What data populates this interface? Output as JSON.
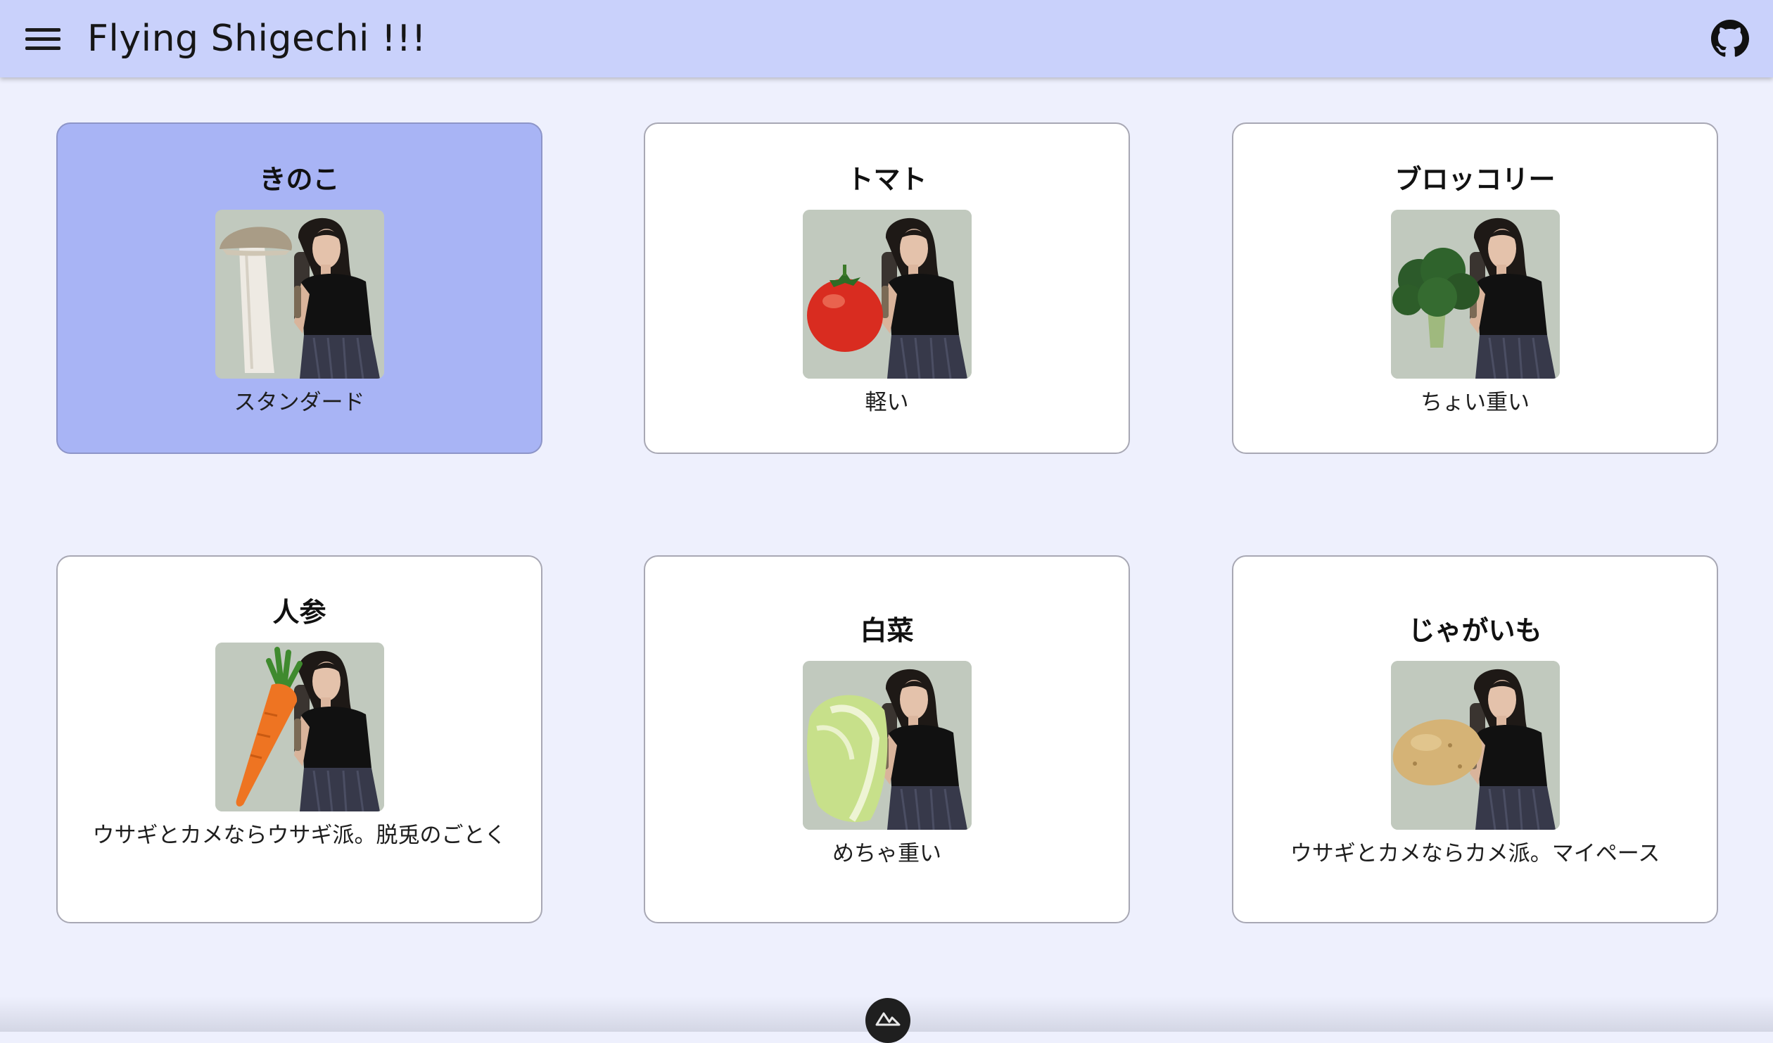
{
  "appbar": {
    "title": "Flying Shigechi !!!",
    "menu_icon": "hamburger-menu-icon",
    "github_icon": "github-icon"
  },
  "cards": [
    {
      "title": "きのこ",
      "caption": "スタンダード",
      "selected": true,
      "vegetable": "king-oyster-mushroom"
    },
    {
      "title": "トマト",
      "caption": "軽い",
      "selected": false,
      "vegetable": "tomato"
    },
    {
      "title": "ブロッコリー",
      "caption": "ちょい重い",
      "selected": false,
      "vegetable": "broccoli"
    },
    {
      "title": "人参",
      "caption": "ウサギとカメならウサギ派。脱兎のごとく",
      "selected": false,
      "vegetable": "carrot"
    },
    {
      "title": "白菜",
      "caption": "めちゃ重い",
      "selected": false,
      "vegetable": "napa-cabbage"
    },
    {
      "title": "じゃがいも",
      "caption": "ウサギとカメならカメ派。マイペース",
      "selected": false,
      "vegetable": "potato"
    }
  ],
  "footer": {
    "devtools_icon": "nuxt-devtools-icon"
  },
  "colors": {
    "appbar": "#c9d1fb",
    "background": "#eef0fd",
    "selected_card": "#a8b4f5",
    "card": "#ffffff"
  }
}
